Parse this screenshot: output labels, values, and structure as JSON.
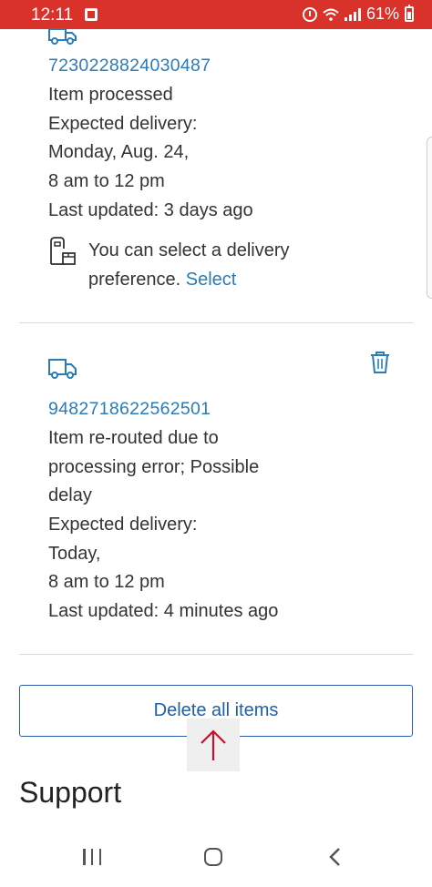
{
  "status_bar": {
    "time": "12:11",
    "battery": "61%",
    "icons": [
      "notification-icon",
      "alarm-icon",
      "wifi-icon",
      "signal-icon",
      "battery-icon"
    ],
    "color": "#d9322b"
  },
  "packages": [
    {
      "tracking_number": "7230228824030487",
      "status": "Item processed",
      "expected_label": "Expected delivery:",
      "expected_day": "Monday, Aug. 24,",
      "expected_window": "8 am to 12 pm",
      "last_updated": "Last updated: 3 days ago",
      "preference_text_1": "You can select a delivery",
      "preference_text_2": "preference.",
      "preference_link": "Select"
    },
    {
      "tracking_number": "9482718622562501",
      "status_line_1": "Item re-routed due to",
      "status_line_2": "processing error; Possible",
      "status_line_3": "delay",
      "expected_label": "Expected delivery:",
      "expected_day": "Today,",
      "expected_window": "8 am to 12 pm",
      "last_updated": "Last updated: 4 minutes ago"
    }
  ],
  "actions": {
    "delete_all_label": "Delete all items"
  },
  "support": {
    "heading": "Support"
  },
  "colors": {
    "link": "#2b7bb9",
    "button_border": "#2a5ea8",
    "text": "#333333",
    "accent_red": "#c8102e"
  }
}
